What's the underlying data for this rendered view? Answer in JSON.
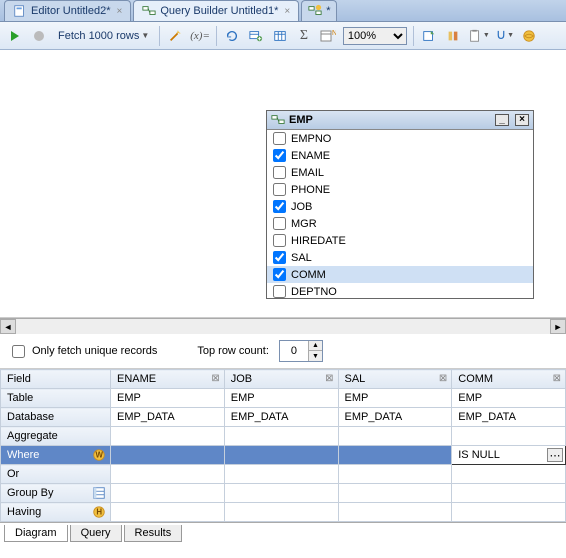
{
  "tabs": {
    "editor": "Editor Untitled2*",
    "query_builder": "Query Builder Untitled1*",
    "new_btn": "*"
  },
  "toolbar": {
    "fetch_label": "Fetch 1000 rows",
    "zoom": "100%"
  },
  "table_window": {
    "title": "EMP",
    "columns": [
      {
        "name": "EMPNO",
        "checked": false
      },
      {
        "name": "ENAME",
        "checked": true
      },
      {
        "name": "EMAIL",
        "checked": false
      },
      {
        "name": "PHONE",
        "checked": false
      },
      {
        "name": "JOB",
        "checked": true
      },
      {
        "name": "MGR",
        "checked": false
      },
      {
        "name": "HIREDATE",
        "checked": false
      },
      {
        "name": "SAL",
        "checked": true
      },
      {
        "name": "COMM",
        "checked": true,
        "selected": true
      },
      {
        "name": "DEPTNO",
        "checked": false
      }
    ]
  },
  "options": {
    "unique_label": "Only fetch unique records",
    "toprow_label": "Top row count:",
    "toprow_value": "0"
  },
  "grid": {
    "row_labels": {
      "field": "Field",
      "table": "Table",
      "database": "Database",
      "aggregate": "Aggregate",
      "where": "Where",
      "or": "Or",
      "group_by": "Group By",
      "having": "Having"
    },
    "columns": [
      {
        "field": "ENAME",
        "table": "EMP",
        "database": "EMP_DATA",
        "aggregate": "",
        "where": "",
        "or": "",
        "group_by": "",
        "having": ""
      },
      {
        "field": "JOB",
        "table": "EMP",
        "database": "EMP_DATA",
        "aggregate": "",
        "where": "",
        "or": "",
        "group_by": "",
        "having": ""
      },
      {
        "field": "SAL",
        "table": "EMP",
        "database": "EMP_DATA",
        "aggregate": "",
        "where": "",
        "or": "",
        "group_by": "",
        "having": ""
      },
      {
        "field": "COMM",
        "table": "EMP",
        "database": "EMP_DATA",
        "aggregate": "",
        "where": "IS NULL",
        "or": "",
        "group_by": "",
        "having": ""
      }
    ]
  },
  "bottom_tabs": {
    "diagram": "Diagram",
    "query": "Query",
    "results": "Results"
  }
}
